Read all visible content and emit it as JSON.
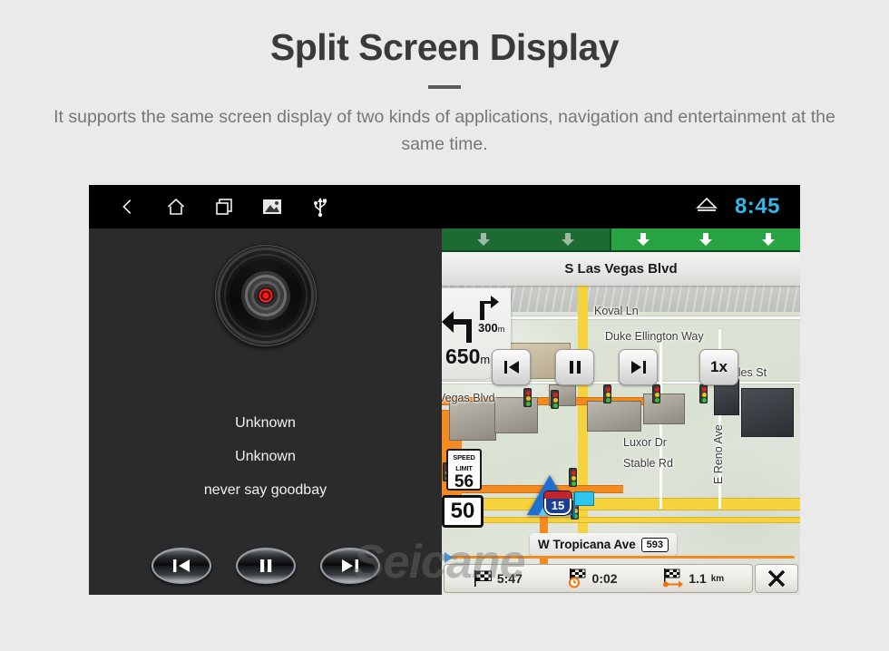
{
  "header": {
    "title": "Split Screen Display",
    "subtitle": "It supports the same screen display of two kinds of applications, navigation and entertainment at the same time."
  },
  "watermark": "Seicane",
  "device": {
    "statusbar": {
      "icons": [
        "back-icon",
        "home-icon",
        "recents-icon",
        "gallery-icon",
        "usb-icon"
      ],
      "eject_icon": "eject-icon",
      "time": "8:45",
      "time_color": "#36b6e8"
    },
    "music_player": {
      "album_art": "vinyl-record",
      "artist": "Unknown",
      "album": "Unknown",
      "track": "never say goodbay",
      "controls": [
        {
          "name": "previous",
          "glyph": "prev"
        },
        {
          "name": "pause",
          "glyph": "pause"
        },
        {
          "name": "next",
          "glyph": "next"
        }
      ]
    },
    "navigation": {
      "lane_guidance": {
        "dim_lanes": 2,
        "lit_lanes": 3,
        "dim_color": "#1d6b33",
        "lit_color": "#27a344"
      },
      "current_road": "S Las Vegas Blvd",
      "turn": {
        "primary_direction": "left",
        "primary_distance": "650",
        "primary_unit": "m",
        "secondary_direction": "right",
        "secondary_distance": "300",
        "secondary_unit": "m"
      },
      "media_overlay": [
        {
          "name": "previous",
          "glyph": "prev",
          "label": ""
        },
        {
          "name": "pause",
          "glyph": "pause",
          "label": ""
        },
        {
          "name": "next",
          "glyph": "next",
          "label": ""
        },
        {
          "name": "speed",
          "glyph": "text",
          "label": "1x"
        }
      ],
      "speed_limit": {
        "line1": "SPEED",
        "line2": "LIMIT",
        "value": "56"
      },
      "current_speed": "50",
      "interstate_shield": "15",
      "street_pill": {
        "name": "W Tropicana Ave",
        "route": "593"
      },
      "map_labels": [
        "Vegas Blvd",
        "Koval Ln",
        "Duke Ellington Way",
        "iles St",
        "Luxor Dr",
        "Stable Rd",
        "E Reno Ave"
      ],
      "trip_stats": [
        {
          "icon": "checkered-flag-icon",
          "value": "5:47"
        },
        {
          "icon": "clock-flag-icon",
          "value": "0:02"
        },
        {
          "icon": "flag-arrow-icon",
          "value": "1.1",
          "unit": "km"
        }
      ],
      "close_label": "close-icon"
    }
  }
}
